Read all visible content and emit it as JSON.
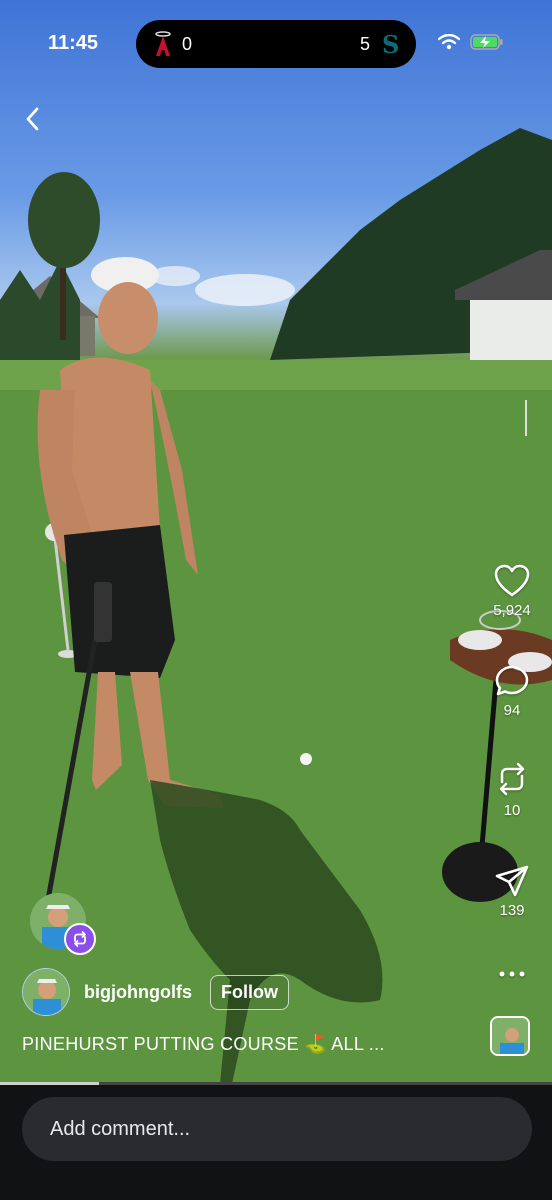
{
  "status": {
    "time": "11:45"
  },
  "score": {
    "home_team_icon": "angels-logo",
    "home_score": "0",
    "away_score": "5",
    "away_team_icon": "mariners-logo"
  },
  "nav": {
    "back_icon": "chevron-left-icon"
  },
  "actions": {
    "like_count": "5,924",
    "comment_count": "94",
    "repost_count": "10",
    "share_count": "139"
  },
  "post": {
    "username": "bigjohngolfs",
    "follow_label": "Follow",
    "caption": "PINEHURST PUTTING COURSE ⛳ ALL ...",
    "progress": 0.18
  },
  "comment": {
    "placeholder": "Add comment..."
  },
  "colors": {
    "accent_remix": "#8a4fe6",
    "bottom_bar": "#111214",
    "comment_field": "#2a2b2f"
  }
}
